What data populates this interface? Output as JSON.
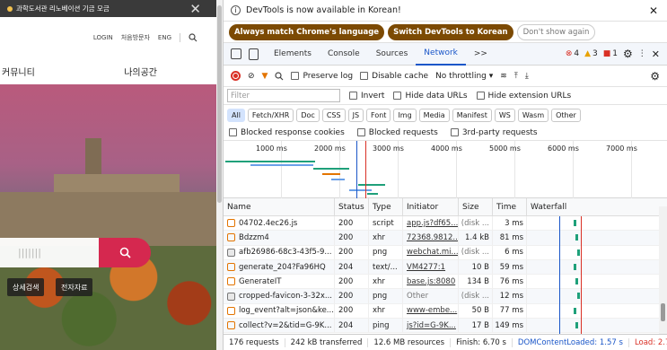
{
  "site": {
    "notice": "과학도서관 리노베이션 기금 모금",
    "util": [
      "LOGIN",
      "처음방문자",
      "ENG"
    ],
    "nav": [
      "커뮤니티",
      "나의공간"
    ],
    "search_placeholder": "|||||||",
    "chips": [
      "상세검색",
      "전자자료"
    ]
  },
  "devtools": {
    "banner": "DevTools is now available in Korean!",
    "banner_buttons": [
      "Always match Chrome's language",
      "Switch DevTools to Korean",
      "Don't show again"
    ],
    "tabs": [
      "Elements",
      "Console",
      "Sources",
      "Network"
    ],
    "active_tab": "Network",
    "more": ">>",
    "errors": "4",
    "warnings": "3",
    "issues": "1",
    "toolbar": {
      "preserve_log": "Preserve log",
      "disable_cache": "Disable cache",
      "throttling": "No throttling"
    },
    "filter_placeholder": "Filter",
    "filter_opts": [
      "Invert",
      "Hide data URLs",
      "Hide extension URLs"
    ],
    "types": [
      "All",
      "Fetch/XHR",
      "Doc",
      "CSS",
      "JS",
      "Font",
      "Img",
      "Media",
      "Manifest",
      "WS",
      "Wasm",
      "Other"
    ],
    "blocked": [
      "Blocked response cookies",
      "Blocked requests",
      "3rd-party requests"
    ],
    "overview_ticks": [
      "1000 ms",
      "2000 ms",
      "3000 ms",
      "4000 ms",
      "5000 ms",
      "6000 ms",
      "7000 ms"
    ],
    "columns": [
      "Name",
      "Status",
      "Type",
      "Initiator",
      "Size",
      "Time",
      "Waterfall"
    ],
    "rows": [
      {
        "name": "04702.4ec26.js",
        "status": "200",
        "type": "script",
        "initiator": "app.js?df65...",
        "size": "(disk ...",
        "time": "3 ms",
        "icon": "js"
      },
      {
        "name": "Bdzzm4",
        "status": "200",
        "type": "xhr",
        "initiator": "72368.9812...",
        "size": "1.4 kB",
        "time": "81 ms",
        "icon": "xhr"
      },
      {
        "name": "afb26986-68c3-43f5-9...",
        "status": "200",
        "type": "png",
        "initiator": "webchat.mi...",
        "size": "(disk ...",
        "time": "6 ms",
        "icon": "img"
      },
      {
        "name": "generate_204?Fa96HQ",
        "status": "204",
        "type": "text/...",
        "initiator": "VM4277:1",
        "size": "10 B",
        "time": "59 ms",
        "icon": "doc"
      },
      {
        "name": "GenerateIT",
        "status": "200",
        "type": "xhr",
        "initiator": "base.js:8080",
        "size": "134 B",
        "time": "76 ms",
        "icon": "xhr"
      },
      {
        "name": "cropped-favicon-3-32x...",
        "status": "200",
        "type": "png",
        "initiator": "Other",
        "size": "(disk ...",
        "time": "12 ms",
        "icon": "img"
      },
      {
        "name": "log_event?alt=json&ke...",
        "status": "200",
        "type": "xhr",
        "initiator": "www-embe...",
        "size": "50 B",
        "time": "77 ms",
        "icon": "xhr"
      },
      {
        "name": "collect?v=2&tid=G-9K...",
        "status": "204",
        "type": "ping",
        "initiator": "js?id=G-9K...",
        "size": "17 B",
        "time": "149 ms",
        "icon": "doc"
      }
    ],
    "status_bar": [
      "176 requests",
      "242 kB transferred",
      "12.6 MB resources",
      "Finish: 6.70 s",
      "DOMContentLoaded: 1.57 s",
      "Load: 2.7"
    ],
    "colors": {
      "accent": "#1a56c8",
      "record": "#d93025",
      "pill": "#7c4a03",
      "dcl": "#1a56c8",
      "load": "#d93025"
    }
  }
}
